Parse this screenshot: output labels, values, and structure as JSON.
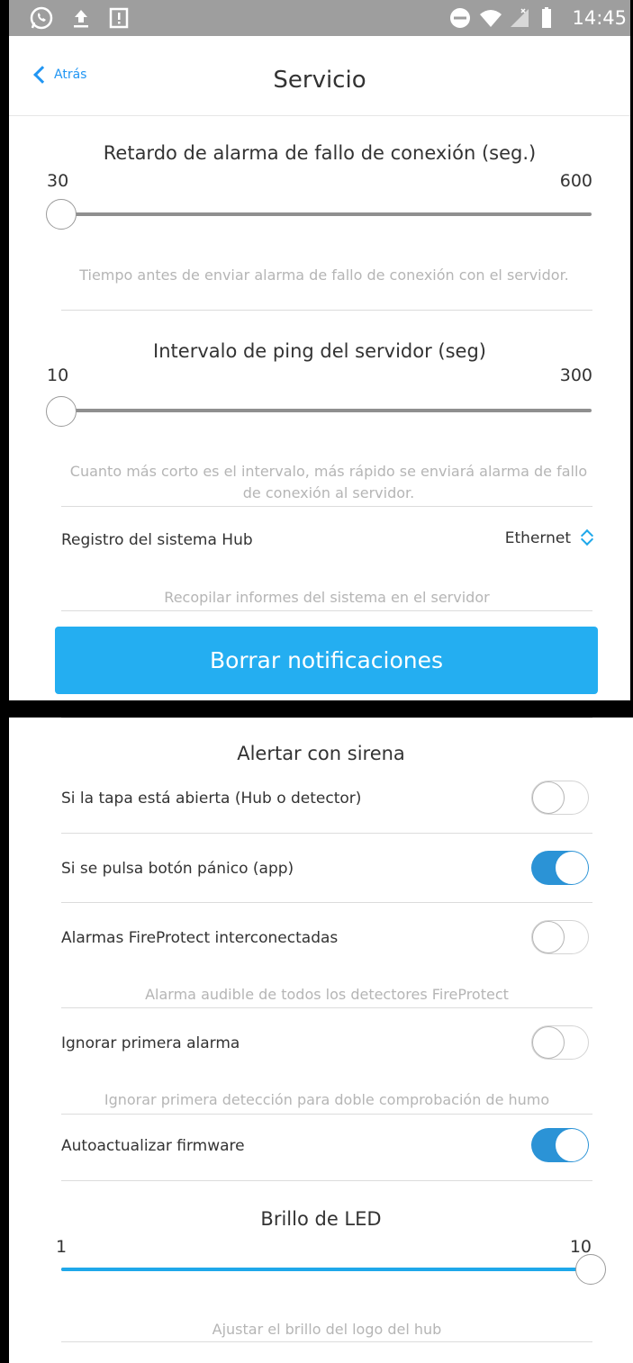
{
  "status_bar": {
    "time": "14:45",
    "left_icons": [
      "whatsapp-icon",
      "upload-icon",
      "notification-alert-icon"
    ],
    "right_icons": [
      "do-not-disturb-icon",
      "wifi-icon",
      "signal-icon",
      "battery-icon"
    ]
  },
  "nav": {
    "back_label": "Atrás",
    "title": "Servicio"
  },
  "connection_failure_delay": {
    "title": "Retardo de alarma de fallo de conexión (seg.)",
    "min": "30",
    "max": "600",
    "value_fraction": 0.0,
    "description": "Tiempo antes de enviar alarma de fallo de conexión con el servidor."
  },
  "ping_interval": {
    "title": "Intervalo de ping del servidor (seg)",
    "min": "10",
    "max": "300",
    "value_fraction": 0.0,
    "description": "Cuanto más corto es el intervalo, más rápido se enviará alarma de fallo de conexión al servidor."
  },
  "hub_log": {
    "label": "Registro del sistema Hub",
    "value": "Ethernet",
    "description": "Recopilar informes del sistema en el servidor"
  },
  "clear_notifications_button": "Borrar notificaciones",
  "siren": {
    "title": "Alertar con sirena",
    "lid_open": {
      "label": "Si la tapa está abierta (Hub o detector)",
      "on": false
    },
    "panic_button": {
      "label": "Si se pulsa botón pánico (app)",
      "on": true
    }
  },
  "fireprotect": {
    "label": "Alarmas FireProtect interconectadas",
    "on": false,
    "description": "Alarma audible de todos los detectores FireProtect"
  },
  "ignore_first_alarm": {
    "label": "Ignorar primera alarma",
    "on": false,
    "description": "Ignorar primera detección para doble comprobación de humo"
  },
  "auto_update": {
    "label": "Autoactualizar firmware",
    "on": true
  },
  "led_brightness": {
    "title": "Brillo de LED",
    "min": "1",
    "max": "10",
    "value_fraction": 1.0,
    "description": "Ajustar el brillo del logo del hub"
  },
  "colors": {
    "accent": "#24aef1",
    "toggle_on": "#2b93d6",
    "status_bar": "#9e9e9e"
  }
}
